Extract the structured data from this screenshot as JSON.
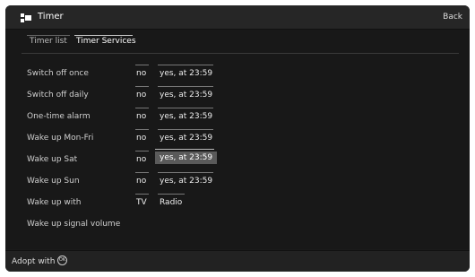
{
  "window": {
    "title": "Timer",
    "back_label": "Back"
  },
  "tabs": [
    {
      "label": "Timer list",
      "active": false
    },
    {
      "label": "Timer Services",
      "active": true
    }
  ],
  "rows": [
    {
      "label": "Switch off once",
      "left": "no",
      "right": "yes, at 23:59"
    },
    {
      "label": "Switch off daily",
      "left": "no",
      "right": "yes, at 23:59"
    },
    {
      "label": "One-time alarm",
      "left": "no",
      "right": "yes, at 23:59"
    },
    {
      "label": "Wake up Mon-Fri",
      "left": "no",
      "right": "yes, at 23:59"
    },
    {
      "label": "Wake up Sat",
      "left": "no",
      "right": "yes, at 23:59",
      "selected": "right"
    },
    {
      "label": "Wake up Sun",
      "left": "no",
      "right": "yes, at 23:59"
    },
    {
      "label": "Wake up with",
      "left": "TV",
      "right": "Radio"
    },
    {
      "label": "Wake up signal volume"
    }
  ],
  "footer": {
    "adopt_label": "Adopt with",
    "ok_icon": "OK"
  },
  "colors": {
    "background": "#181818",
    "titlebar": "#262626",
    "selected": "#5a5a5a"
  }
}
